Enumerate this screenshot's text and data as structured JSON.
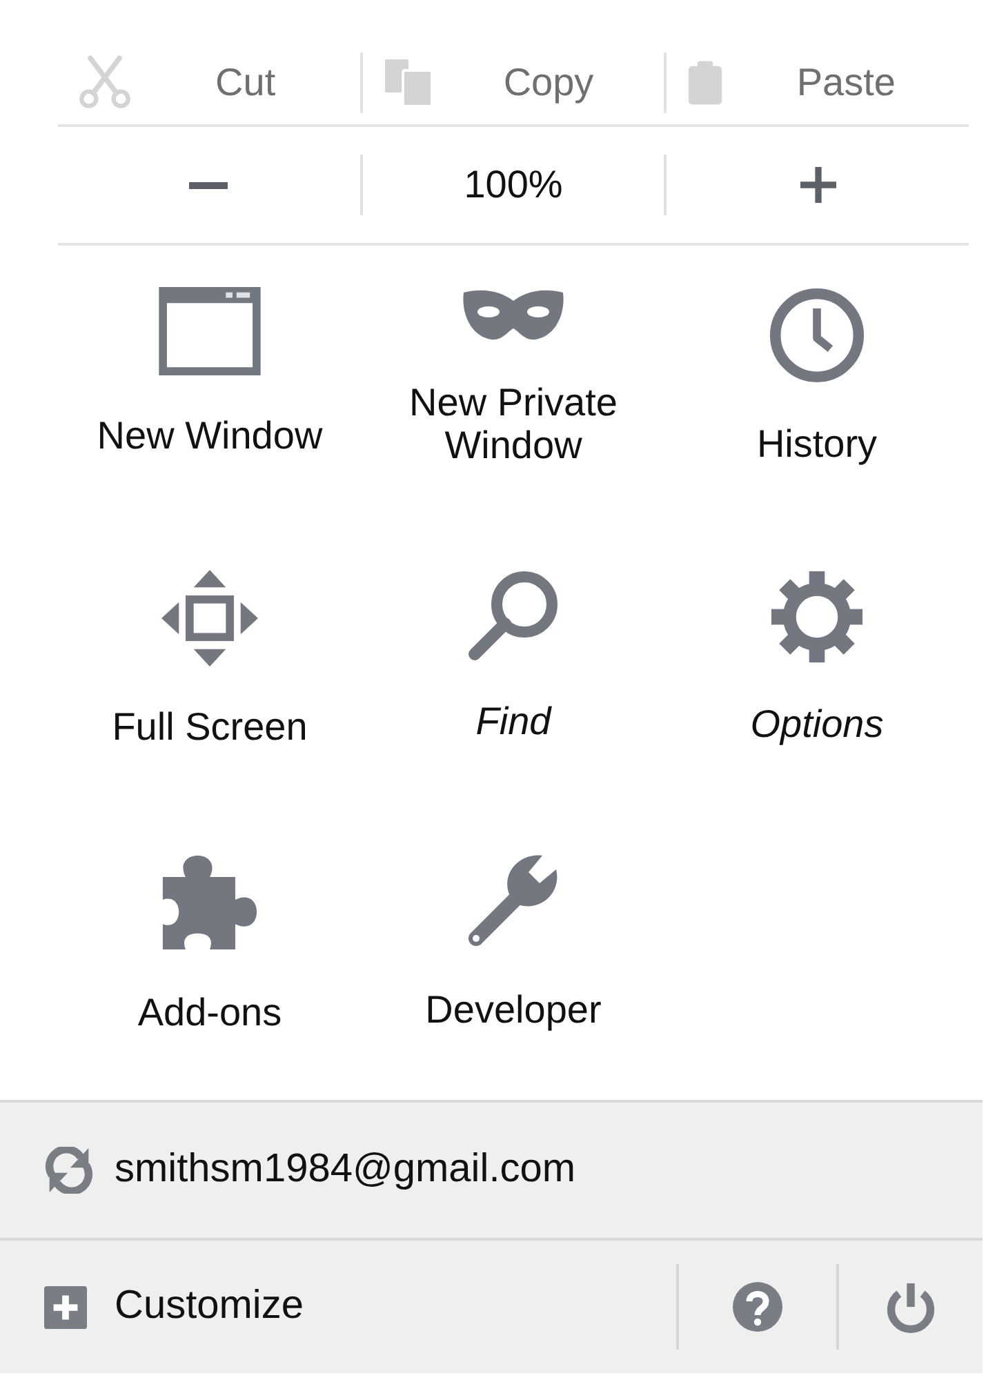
{
  "edit_controls": [
    {
      "label": "Cut",
      "disabled": true
    },
    {
      "label": "Copy",
      "disabled": true
    },
    {
      "label": "Paste",
      "disabled": true
    }
  ],
  "zoom_controls": {
    "reset_label": "100%"
  },
  "tools": [
    {
      "label": "New Window",
      "italic": false
    },
    {
      "label": "New Private Window",
      "italic": false
    },
    {
      "label": "History",
      "italic": false
    },
    {
      "label": "Full Screen",
      "italic": false
    },
    {
      "label": "Find",
      "italic": true
    },
    {
      "label": "Options",
      "italic": true
    },
    {
      "label": "Add-ons",
      "italic": false
    },
    {
      "label": "Developer",
      "italic": false
    }
  ],
  "account": {
    "email": "smithsm1984@gmail.com"
  },
  "footer": {
    "customize_label": "Customize"
  }
}
